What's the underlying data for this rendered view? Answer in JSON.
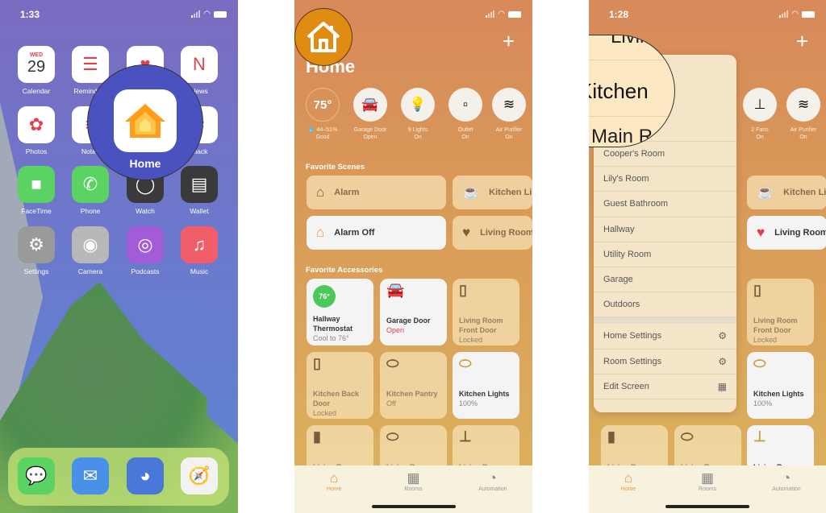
{
  "screen1": {
    "time": "1:33",
    "apps": [
      {
        "label": "Calendar",
        "icon": "calendar-icon",
        "glyph": "29",
        "sub": "WED",
        "bg": "#ffffff"
      },
      {
        "label": "Reminders",
        "icon": "reminders-icon",
        "glyph": "☰",
        "bg": "#ffffff"
      },
      {
        "label": "Health",
        "icon": "health-icon",
        "glyph": "♥",
        "bg": "#ffffff"
      },
      {
        "label": "News",
        "icon": "news-icon",
        "glyph": "N",
        "bg": "#ffffff"
      },
      {
        "label": "Photos",
        "icon": "photos-icon",
        "glyph": "✿",
        "bg": "#ffffff"
      },
      {
        "label": "Notes",
        "icon": "notes-icon",
        "glyph": "≡",
        "bg": "#ffffff"
      },
      {
        "label": "",
        "icon": "app-icon",
        "glyph": "",
        "bg": "#ffffff"
      },
      {
        "label": "Slack",
        "icon": "slack-icon",
        "glyph": "#",
        "bg": "#ffffff"
      },
      {
        "label": "FaceTime",
        "icon": "facetime-icon",
        "glyph": "■",
        "bg": "#5ad363"
      },
      {
        "label": "Phone",
        "icon": "phone-icon",
        "glyph": "✆",
        "bg": "#5ad363"
      },
      {
        "label": "Watch",
        "icon": "watch-icon",
        "glyph": "◯",
        "bg": "#3a3a3a"
      },
      {
        "label": "Wallet",
        "icon": "wallet-icon",
        "glyph": "▤",
        "bg": "#3a3a3a"
      },
      {
        "label": "Settings",
        "icon": "settings-icon",
        "glyph": "⚙",
        "bg": "#9a9a9a"
      },
      {
        "label": "Camera",
        "icon": "camera-icon",
        "glyph": "◉",
        "bg": "#b8b8b8"
      },
      {
        "label": "Podcasts",
        "icon": "podcasts-icon",
        "glyph": "◎",
        "bg": "#a35cd8"
      },
      {
        "label": "Music",
        "icon": "music-icon",
        "glyph": "♫",
        "bg": "#f25d6a"
      }
    ],
    "dock": [
      {
        "icon": "messages-icon",
        "glyph": "💬",
        "bg": "#5ad363"
      },
      {
        "icon": "mail-icon",
        "glyph": "✉",
        "bg": "#4a90e8"
      },
      {
        "icon": "tweetbot-icon",
        "glyph": "◕",
        "bg": "#4a78d8"
      },
      {
        "icon": "safari-icon",
        "glyph": "🧭",
        "bg": "#f2f2f2"
      }
    ],
    "magnified": {
      "label": "Home",
      "icon": "home-app-icon"
    }
  },
  "screen2": {
    "title": "Home",
    "status": [
      {
        "value": "75°",
        "line1": "💧 44–51%",
        "line2": "Good",
        "icon": "thermometer-icon"
      },
      {
        "glyph": "🚘",
        "line1": "Garage Door",
        "line2": "Open",
        "icon": "garage-icon"
      },
      {
        "glyph": "💡",
        "line1": "9 Lights",
        "line2": "On",
        "icon": "lightbulb-icon"
      },
      {
        "glyph": "▫",
        "line1": "Outlet",
        "line2": "On",
        "icon": "outlet-icon"
      },
      {
        "glyph": "≋",
        "line1": "Air Purifier",
        "line2": "On",
        "icon": "air-purifier-icon"
      }
    ],
    "scenes_title": "Favorite Scenes",
    "scenes": [
      {
        "label": "Alarm",
        "glyph": "⌂",
        "on": false,
        "icon": "alarm-scene-icon"
      },
      {
        "label": "Kitchen Lights",
        "glyph": "☕",
        "on": false,
        "icon": "mug-icon"
      },
      {
        "label": "Alarm Off",
        "glyph": "⌂",
        "on": true,
        "icon": "alarm-off-scene-icon"
      },
      {
        "label": "Living Room",
        "glyph": "♥",
        "on": false,
        "icon": "heart-icon"
      }
    ],
    "accessories_title": "Favorite Accessories",
    "accessories": [
      {
        "name": "Hallway Thermostat",
        "status": "Cool to 76°",
        "on": true,
        "glyph": "76°",
        "icon": "thermostat-icon"
      },
      {
        "name": "Garage Door",
        "status": "Open",
        "on": true,
        "red": true,
        "glyph": "🚘",
        "icon": "garage-icon"
      },
      {
        "name": "Living Room Front Door",
        "status": "Locked",
        "on": false,
        "glyph": "▯",
        "icon": "lock-icon"
      },
      {
        "name": "Kitchen Back Door",
        "status": "Locked",
        "on": false,
        "glyph": "▯",
        "icon": "lock-icon"
      },
      {
        "name": "Kitchen Pantry",
        "status": "Off",
        "on": false,
        "glyph": "⬭",
        "icon": "ceiling-light-icon"
      },
      {
        "name": "Kitchen Lights",
        "status": "100%",
        "on": true,
        "glyph": "⬭",
        "icon": "ceiling-light-icon"
      },
      {
        "name": "Living Room",
        "status": "",
        "on": false,
        "glyph": "▮",
        "icon": "light-strip-icon"
      },
      {
        "name": "Living Room",
        "status": "",
        "on": false,
        "glyph": "⬭",
        "icon": "ceiling-light-icon"
      },
      {
        "name": "Living Room",
        "status": "",
        "on": false,
        "glyph": "⊥",
        "icon": "fan-icon"
      }
    ],
    "tabs": [
      {
        "label": "Home",
        "glyph": "⌂",
        "active": true
      },
      {
        "label": "Rooms",
        "glyph": "▦",
        "active": false
      },
      {
        "label": "Automation",
        "glyph": "◔",
        "active": false
      }
    ]
  },
  "screen3": {
    "time": "1:28",
    "status": [
      {
        "glyph": "⊥",
        "line1": "2 Fans",
        "line2": "On",
        "icon": "fan-icon"
      },
      {
        "glyph": "≋",
        "line1": "Air Purifier",
        "line2": "On",
        "icon": "air-purifier-icon"
      }
    ],
    "scenes": [
      {
        "label": "Kitchen Lights",
        "glyph": "☕",
        "on": false,
        "icon": "mug-icon"
      },
      {
        "label": "Living Room",
        "glyph": "♥",
        "on": true,
        "icon": "heart-icon"
      }
    ],
    "accessories": [
      {
        "name": "Living Room Front Door",
        "status": "Locked",
        "on": false,
        "glyph": "▯",
        "icon": "lock-icon"
      },
      {
        "name": "Kitchen Lights",
        "status": "100%",
        "on": true,
        "glyph": "⬭",
        "icon": "ceiling-light-icon"
      },
      {
        "name": "Living Room",
        "status": "",
        "on": false,
        "glyph": "▮",
        "icon": "light-strip-icon"
      },
      {
        "name": "Living Room",
        "status": "",
        "on": false,
        "glyph": "⬭",
        "icon": "ceiling-light-icon"
      },
      {
        "name": "Living Room",
        "status": "",
        "on": true,
        "glyph": "⊥",
        "icon": "fan-icon"
      }
    ],
    "magnified": {
      "above": "Living Room",
      "selected": "Kitchen",
      "below": "Main Room"
    },
    "rooms": [
      "Cooper's Room",
      "Lily's Room",
      "Guest Bathroom",
      "Hallway",
      "Utility Room",
      "Garage",
      "Outdoors"
    ],
    "actions": [
      {
        "label": "Home Settings",
        "glyph": "⚙",
        "icon": "home-settings-icon"
      },
      {
        "label": "Room Settings",
        "glyph": "⚙",
        "icon": "room-settings-icon"
      },
      {
        "label": "Edit Screen",
        "glyph": "▦",
        "icon": "edit-screen-icon"
      }
    ]
  },
  "colors": {
    "accent": "#f0963a",
    "badge": "#e08b12",
    "open": "#e8394a"
  }
}
